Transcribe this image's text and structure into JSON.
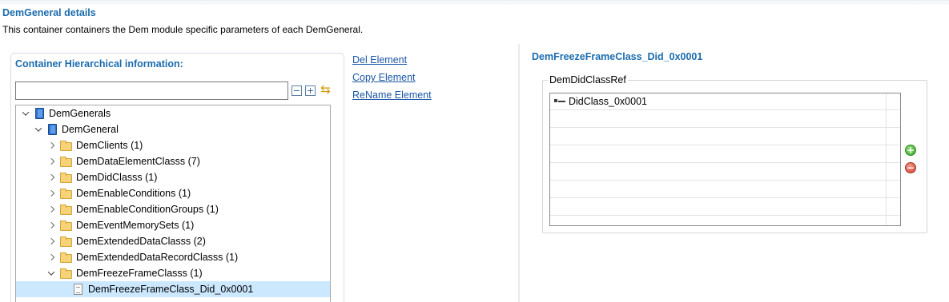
{
  "page": {
    "title": "DemGeneral details",
    "description": "This container containers the Dem module specific parameters of each DemGeneral."
  },
  "left_panel": {
    "title": "Container Hierarchical information:",
    "filter_value": "",
    "tree": [
      {
        "label": "DemGenerals",
        "level": 0,
        "expanded": true,
        "icon": "book-icon"
      },
      {
        "label": "DemGeneral",
        "level": 1,
        "expanded": true,
        "icon": "book-icon"
      },
      {
        "label": "DemClients (1)",
        "level": 2,
        "expanded": false,
        "icon": "folder-icon"
      },
      {
        "label": "DemDataElementClasss (7)",
        "level": 2,
        "expanded": false,
        "icon": "folder-icon"
      },
      {
        "label": "DemDidClasss (1)",
        "level": 2,
        "expanded": false,
        "icon": "folder-icon"
      },
      {
        "label": "DemEnableConditions (1)",
        "level": 2,
        "expanded": false,
        "icon": "folder-icon"
      },
      {
        "label": "DemEnableConditionGroups (1)",
        "level": 2,
        "expanded": false,
        "icon": "folder-icon"
      },
      {
        "label": "DemEventMemorySets (1)",
        "level": 2,
        "expanded": false,
        "icon": "folder-icon"
      },
      {
        "label": "DemExtendedDataClasss (2)",
        "level": 2,
        "expanded": false,
        "icon": "folder-icon"
      },
      {
        "label": "DemExtendedDataRecordClasss (1)",
        "level": 2,
        "expanded": false,
        "icon": "folder-icon"
      },
      {
        "label": "DemFreezeFrameClasss (1)",
        "level": 2,
        "expanded": true,
        "icon": "folder-icon"
      },
      {
        "label": "DemFreezeFrameClass_Did_0x0001",
        "level": 3,
        "leaf": true,
        "selected": true,
        "icon": "document-icon"
      }
    ]
  },
  "actions": {
    "del": "Del Element",
    "copy": "Copy Element",
    "rename": "ReName Element"
  },
  "right_panel": {
    "title": "DemFreezeFrameClass_Did_0x0001",
    "group_label": "DemDidClassRef",
    "rows": [
      "DidClass_0x0001"
    ],
    "add_symbol": "+",
    "remove_symbol": "−"
  },
  "colors": {
    "heading": "#1b6cae",
    "link": "#1b56a6",
    "selection": "#cce8ff"
  }
}
